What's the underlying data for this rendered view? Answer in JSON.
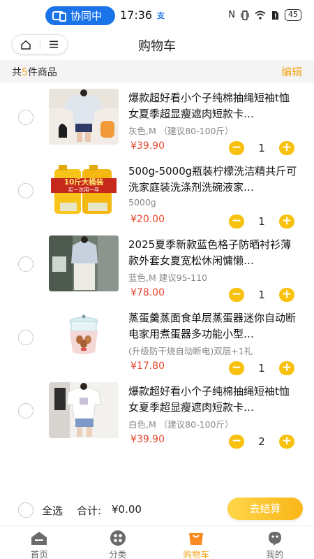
{
  "status_bar": {
    "collab_label": "协同中",
    "time": "17:36",
    "time_badge": "支",
    "battery": "45"
  },
  "header": {
    "title": "购物车"
  },
  "summary": {
    "prefix": "共",
    "count": "5",
    "suffix": "件商品",
    "edit_label": "编辑"
  },
  "items": [
    {
      "title": "爆款超好看小个子纯棉抽绳短袖t恤女夏季超显瘦遮肉短款卡…",
      "spec": "灰色,M （建议80-100斤）",
      "price": "¥39.90",
      "qty": "1",
      "minus": "−",
      "plus": "+"
    },
    {
      "title": "500g-5000g瓶装柠檬洗洁精共斤可洗家庭装洗涤剂洗碗液家…",
      "spec": "5000g",
      "price": "¥20.00",
      "qty": "1",
      "minus": "−",
      "plus": "+",
      "banner_text": "10斤大桶装",
      "banner_sub": "买一次用一年"
    },
    {
      "title": "2025夏季新款蓝色格子防晒衬衫薄款外套女夏宽松休闲慵懒…",
      "spec": "蓝色,M 建议95-110",
      "price": "¥78.00",
      "qty": "1",
      "minus": "−",
      "plus": "+"
    },
    {
      "title": "蒸蛋羹蒸面食单层蒸蛋器迷你自动断电家用煮蛋器多功能小型…",
      "spec": "(升级防干烧自动断电)双层+1礼",
      "price": "¥17.80",
      "qty": "1",
      "minus": "−",
      "plus": "+"
    },
    {
      "title": "爆款超好看小个子纯棉抽绳短袖t恤女夏季超显瘦遮肉短款卡…",
      "spec": "白色,M （建议80-100斤）",
      "price": "¥39.90",
      "qty": "2",
      "minus": "−",
      "plus": "+"
    }
  ],
  "action_bar": {
    "select_all": "全选",
    "total_label": "合计:",
    "total_value": "¥0.00",
    "checkout": "去结算"
  },
  "tabs": [
    {
      "label": "首页",
      "icon": "home-icon",
      "active": false
    },
    {
      "label": "分类",
      "icon": "category-icon",
      "active": false
    },
    {
      "label": "购物车",
      "icon": "cart-icon",
      "active": true
    },
    {
      "label": "我的",
      "icon": "profile-icon",
      "active": false
    }
  ],
  "colors": {
    "accent": "#f5a623",
    "price": "#e6462f",
    "stepper": "#f7c10e",
    "collab_pill": "#1a73e8"
  }
}
